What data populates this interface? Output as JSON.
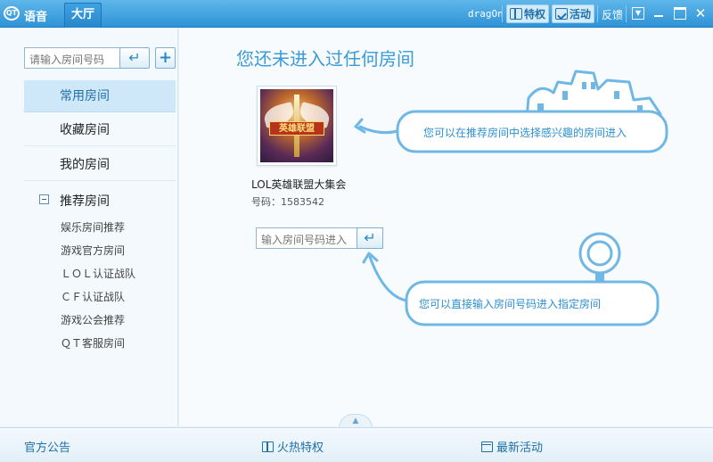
{
  "titlebar": {
    "app_name": "语音",
    "tab_hall": "大厅",
    "username": "dragOn",
    "privilege_label": "特权",
    "activity_label": "活动",
    "feedback_label": "反馈",
    "window_controls": [
      "menu-icon",
      "minimize-icon",
      "maximize-icon",
      "close-icon"
    ]
  },
  "sidebar": {
    "search_placeholder": "请输入房间号码",
    "search_submit_icon": "enter-arrow-icon",
    "add_icon": "plus-icon",
    "items": [
      {
        "label": "常用房间",
        "active": true
      },
      {
        "label": "收藏房间",
        "active": false
      },
      {
        "label": "我的房间",
        "active": false
      }
    ],
    "recommended": {
      "label": "推荐房间",
      "expanded": true,
      "children": [
        "娱乐房间推荐",
        "游戏官方房间",
        "ＬＯＬ认证战队",
        "ＣＦ认证战队",
        "游戏公会推荐",
        "ＱＴ客服房间"
      ]
    }
  },
  "main": {
    "title": "您还未进入过任何房间",
    "room": {
      "thumb_text": "英雄联盟",
      "name": "LOL英雄联盟大集会",
      "id": "号码：1583542"
    },
    "enter_placeholder": "输入房间号码进入",
    "hint_recommend": "您可以在推荐房间中选择感兴趣的房间进入",
    "hint_enter": "您可以直接输入房间号码进入指定房间",
    "accent": "#3a9bd9"
  },
  "footer": {
    "announcement": "官方公告",
    "hot_privileges": "火热特权",
    "latest_activity": "最新活动"
  }
}
